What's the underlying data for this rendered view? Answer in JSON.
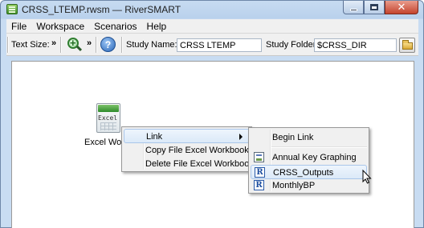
{
  "window": {
    "title": "CRSS_LTEMP.rwsm — RiverSMART",
    "close_glyph": "✕"
  },
  "menu": [
    "File",
    "Workspace",
    "Scenarios",
    "Help"
  ],
  "toolbar": {
    "text_size_label": "Text Size:",
    "chevron": "»",
    "help_glyph": "?",
    "study_name_label": "Study Name:",
    "study_name_value": "CRSS LTEMP",
    "study_folder_label": "Study Folder:",
    "study_folder_value": "$CRSS_DIR"
  },
  "canvas": {
    "node": {
      "icon_text": "Excel",
      "label": "Excel Workb"
    }
  },
  "context_menu": {
    "items": [
      {
        "label": "Link",
        "has_submenu": true
      },
      {
        "label": "Copy File Excel Workbook"
      },
      {
        "label": "Delete File Excel Workbook"
      }
    ]
  },
  "submenu": {
    "items": [
      {
        "label": "Begin Link",
        "icon": "none"
      },
      {
        "label": "Annual Key Graphing",
        "icon": "graph-icon"
      },
      {
        "label": "CRSS_Outputs",
        "icon": "r-icon",
        "highlighted": true
      },
      {
        "label": "MonthlyBP",
        "icon": "r-icon"
      }
    ],
    "r_icon_text": "R"
  },
  "colors": {
    "titlebar": "#b9d1ec",
    "close_button": "#c4442d",
    "highlight": "#dbe9f8"
  }
}
